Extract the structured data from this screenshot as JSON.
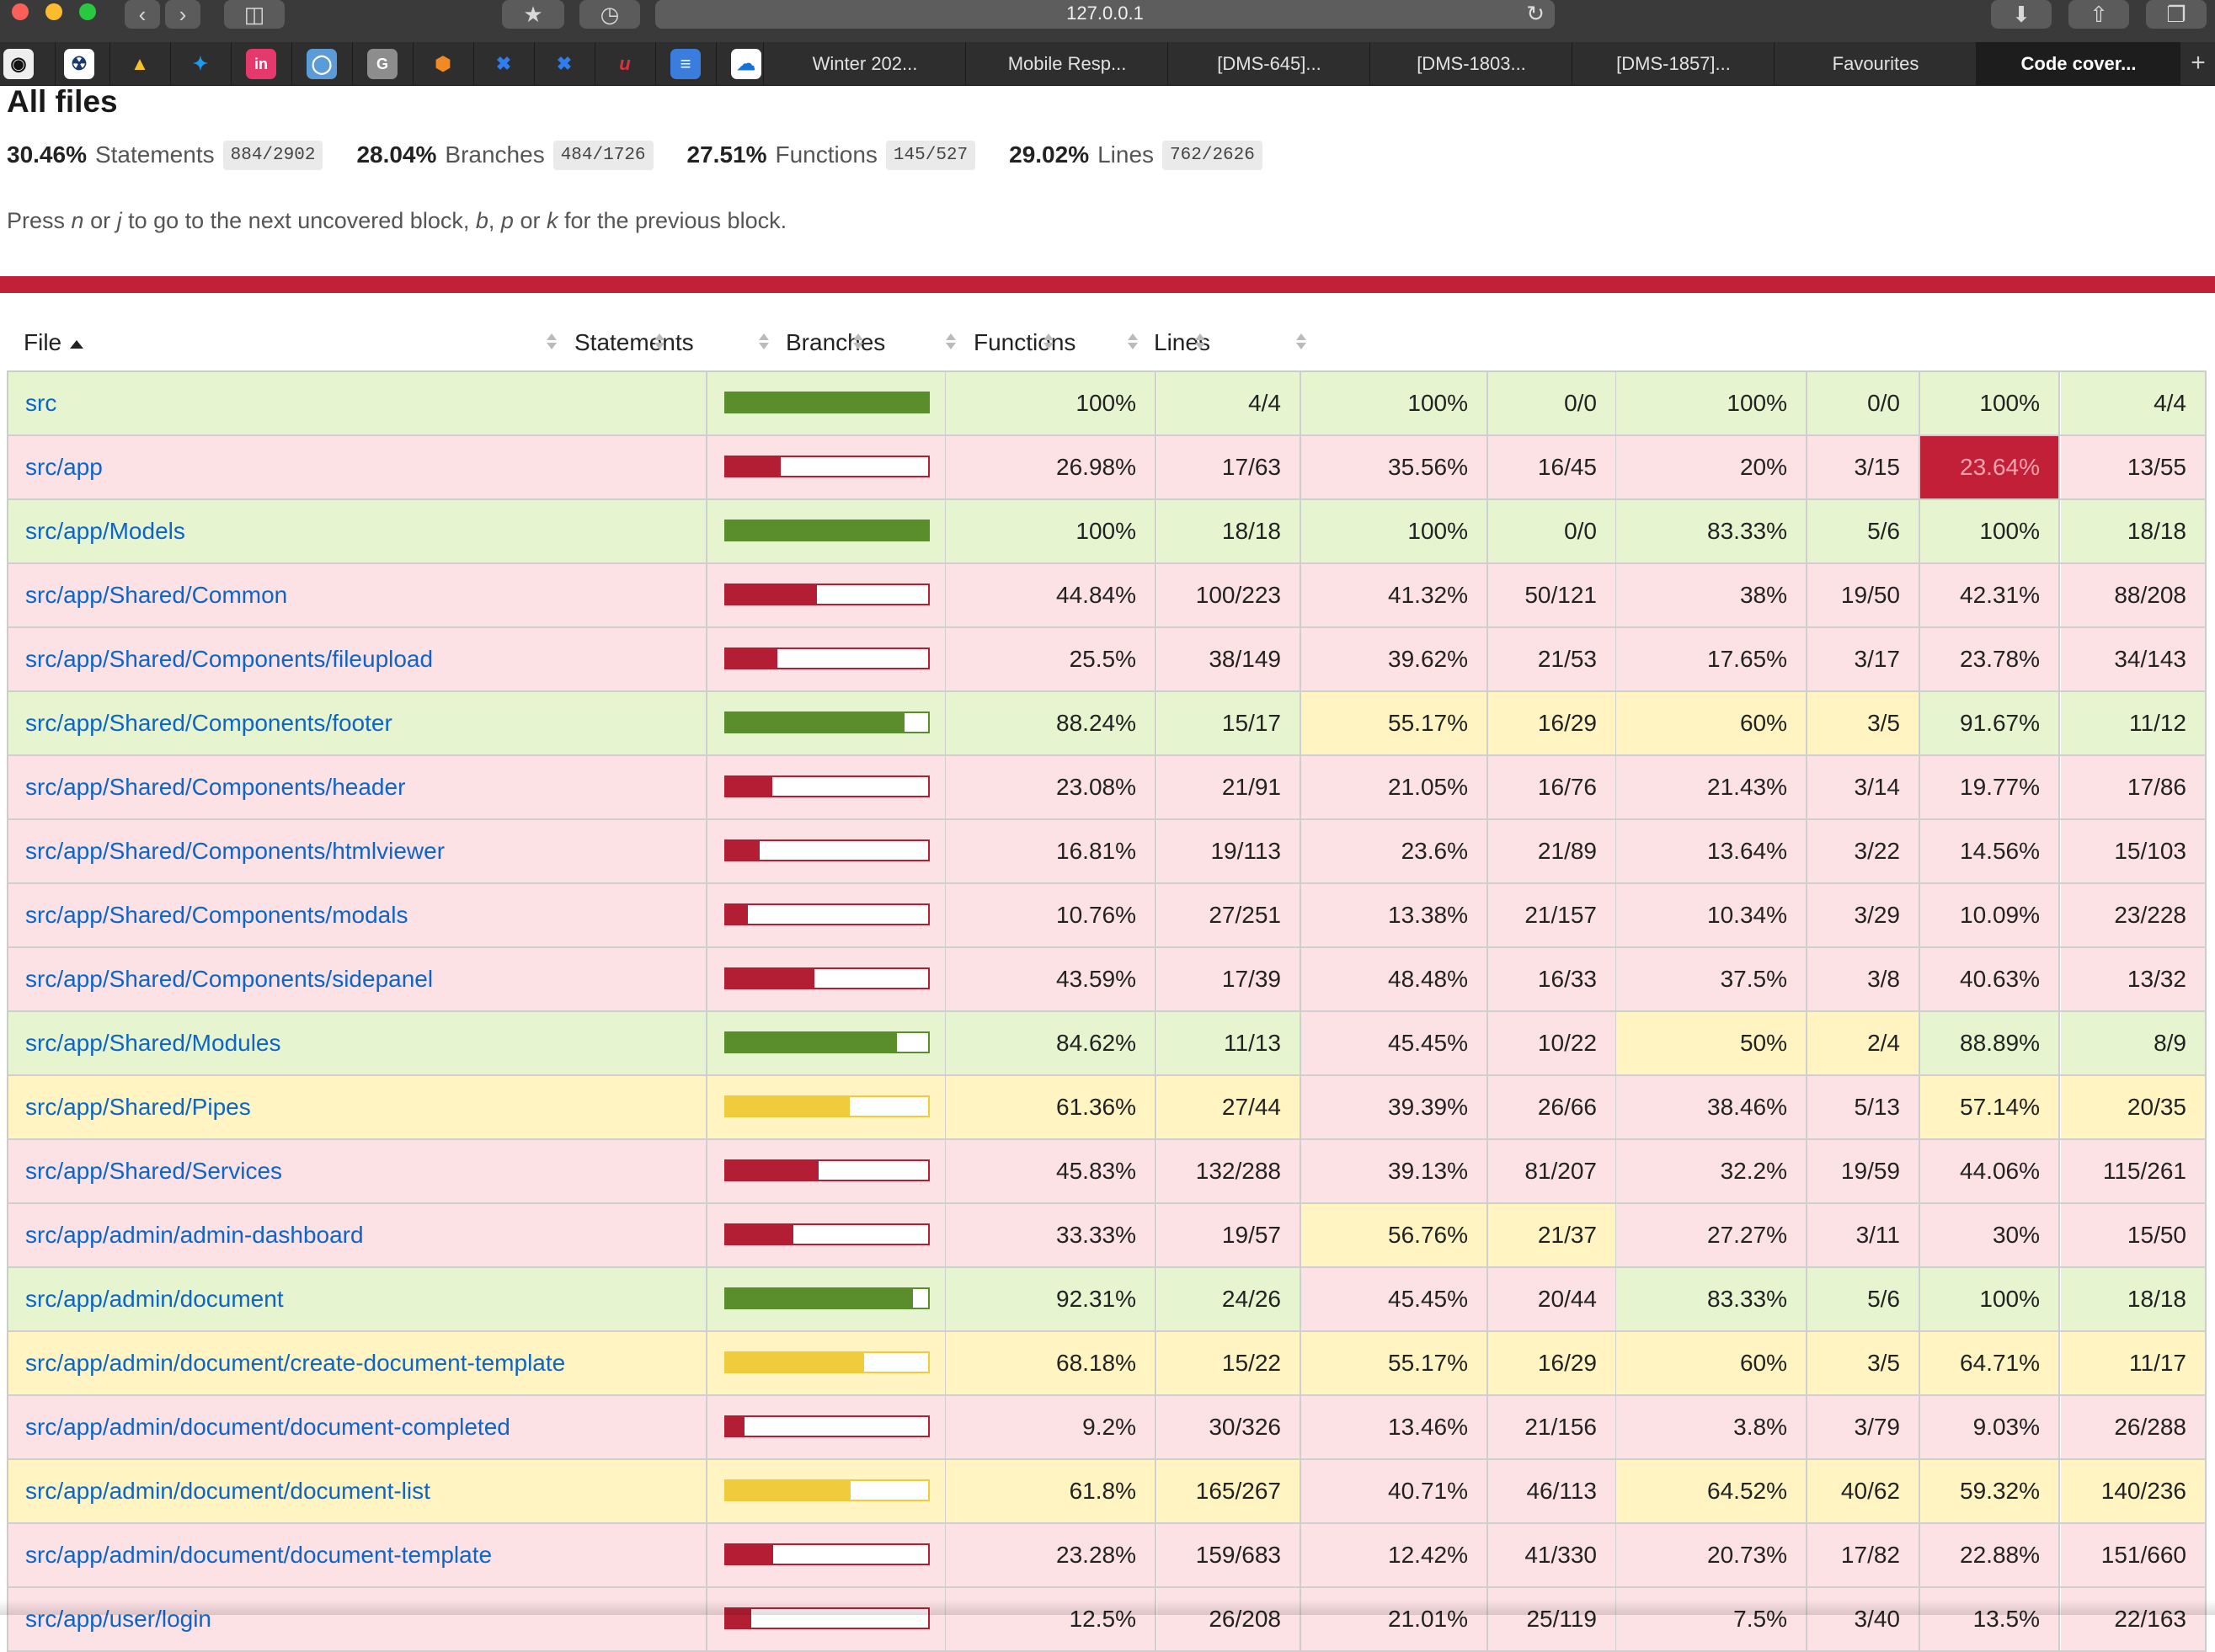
{
  "browser": {
    "url": "127.0.0.1",
    "tabs": [
      {
        "label": "Winter 202..."
      },
      {
        "label": "Mobile Resp..."
      },
      {
        "label": "[DMS-645]..."
      },
      {
        "label": "[DMS-1803..."
      },
      {
        "label": "[DMS-1857]..."
      },
      {
        "label": "Favourites"
      },
      {
        "label": "Code cover...",
        "active": true
      }
    ],
    "favorites_icons": [
      "github-icon",
      "bot-icon",
      "google-drive-icon",
      "twitter-icon",
      "invision-icon",
      "circle-app-icon",
      "grammarly-icon",
      "package-icon",
      "jira-icon",
      "jira-icon",
      "signature-icon",
      "google-docs-icon",
      "onedrive-icon"
    ]
  },
  "page": {
    "title": "All files",
    "summary": [
      {
        "pct": "30.46%",
        "label": "Statements",
        "fraction": "884/2902"
      },
      {
        "pct": "28.04%",
        "label": "Branches",
        "fraction": "484/1726"
      },
      {
        "pct": "27.51%",
        "label": "Functions",
        "fraction": "145/527"
      },
      {
        "pct": "29.02%",
        "label": "Lines",
        "fraction": "762/2626"
      }
    ],
    "hint": {
      "p1": "Press ",
      "k1": "n",
      "p2": " or ",
      "k2": "j",
      "p3": " to go to the next uncovered block, ",
      "k3": "b",
      "p4": ", ",
      "k4": "p",
      "p5": " or ",
      "k5": "k",
      "p6": " for the previous block."
    },
    "status_color": "#c21f39"
  },
  "table": {
    "headers": {
      "file": "File",
      "statements": "Statements",
      "branches": "Branches",
      "functions": "Functions",
      "lines": "Lines"
    },
    "rows": [
      {
        "file": "src",
        "bar": 1.0,
        "level": "high",
        "stmt_pct": "100%",
        "stmt": "4/4",
        "br_pct": "100%",
        "br": "0/0",
        "fn_pct": "100%",
        "fn": "0/0",
        "ln_pct": "100%",
        "ln": "4/4",
        "levels": [
          "high",
          "high",
          "high",
          "high"
        ]
      },
      {
        "file": "src/app",
        "bar": 0.2698,
        "level": "low",
        "stmt_pct": "26.98%",
        "stmt": "17/63",
        "br_pct": "35.56%",
        "br": "16/45",
        "fn_pct": "20%",
        "fn": "3/15",
        "ln_pct": "23.64%",
        "ln": "13/55",
        "levels": [
          "low",
          "low",
          "low",
          "alert"
        ]
      },
      {
        "file": "src/app/Models",
        "bar": 1.0,
        "level": "high",
        "stmt_pct": "100%",
        "stmt": "18/18",
        "br_pct": "100%",
        "br": "0/0",
        "fn_pct": "83.33%",
        "fn": "5/6",
        "ln_pct": "100%",
        "ln": "18/18",
        "levels": [
          "high",
          "high",
          "high",
          "high"
        ]
      },
      {
        "file": "src/app/Shared/Common",
        "bar": 0.4484,
        "level": "low",
        "stmt_pct": "44.84%",
        "stmt": "100/223",
        "br_pct": "41.32%",
        "br": "50/121",
        "fn_pct": "38%",
        "fn": "19/50",
        "ln_pct": "42.31%",
        "ln": "88/208",
        "levels": [
          "low",
          "low",
          "low",
          "low"
        ]
      },
      {
        "file": "src/app/Shared/Components/fileupload",
        "bar": 0.255,
        "level": "low",
        "stmt_pct": "25.5%",
        "stmt": "38/149",
        "br_pct": "39.62%",
        "br": "21/53",
        "fn_pct": "17.65%",
        "fn": "3/17",
        "ln_pct": "23.78%",
        "ln": "34/143",
        "levels": [
          "low",
          "low",
          "low",
          "low"
        ]
      },
      {
        "file": "src/app/Shared/Components/footer",
        "bar": 0.8824,
        "level": "high",
        "stmt_pct": "88.24%",
        "stmt": "15/17",
        "br_pct": "55.17%",
        "br": "16/29",
        "fn_pct": "60%",
        "fn": "3/5",
        "ln_pct": "91.67%",
        "ln": "11/12",
        "levels": [
          "high",
          "medium",
          "medium",
          "high"
        ]
      },
      {
        "file": "src/app/Shared/Components/header",
        "bar": 0.2308,
        "level": "low",
        "stmt_pct": "23.08%",
        "stmt": "21/91",
        "br_pct": "21.05%",
        "br": "16/76",
        "fn_pct": "21.43%",
        "fn": "3/14",
        "ln_pct": "19.77%",
        "ln": "17/86",
        "levels": [
          "low",
          "low",
          "low",
          "low"
        ]
      },
      {
        "file": "src/app/Shared/Components/htmlviewer",
        "bar": 0.1681,
        "level": "low",
        "stmt_pct": "16.81%",
        "stmt": "19/113",
        "br_pct": "23.6%",
        "br": "21/89",
        "fn_pct": "13.64%",
        "fn": "3/22",
        "ln_pct": "14.56%",
        "ln": "15/103",
        "levels": [
          "low",
          "low",
          "low",
          "low"
        ]
      },
      {
        "file": "src/app/Shared/Components/modals",
        "bar": 0.1076,
        "level": "low",
        "stmt_pct": "10.76%",
        "stmt": "27/251",
        "br_pct": "13.38%",
        "br": "21/157",
        "fn_pct": "10.34%",
        "fn": "3/29",
        "ln_pct": "10.09%",
        "ln": "23/228",
        "levels": [
          "low",
          "low",
          "low",
          "low"
        ]
      },
      {
        "file": "src/app/Shared/Components/sidepanel",
        "bar": 0.4359,
        "level": "low",
        "stmt_pct": "43.59%",
        "stmt": "17/39",
        "br_pct": "48.48%",
        "br": "16/33",
        "fn_pct": "37.5%",
        "fn": "3/8",
        "ln_pct": "40.63%",
        "ln": "13/32",
        "levels": [
          "low",
          "low",
          "low",
          "low"
        ]
      },
      {
        "file": "src/app/Shared/Modules",
        "bar": 0.8462,
        "level": "high",
        "stmt_pct": "84.62%",
        "stmt": "11/13",
        "br_pct": "45.45%",
        "br": "10/22",
        "fn_pct": "50%",
        "fn": "2/4",
        "ln_pct": "88.89%",
        "ln": "8/9",
        "levels": [
          "high",
          "low",
          "medium",
          "high"
        ]
      },
      {
        "file": "src/app/Shared/Pipes",
        "bar": 0.6136,
        "level": "medium",
        "stmt_pct": "61.36%",
        "stmt": "27/44",
        "br_pct": "39.39%",
        "br": "26/66",
        "fn_pct": "38.46%",
        "fn": "5/13",
        "ln_pct": "57.14%",
        "ln": "20/35",
        "levels": [
          "medium",
          "low",
          "low",
          "medium"
        ]
      },
      {
        "file": "src/app/Shared/Services",
        "bar": 0.4583,
        "level": "low",
        "stmt_pct": "45.83%",
        "stmt": "132/288",
        "br_pct": "39.13%",
        "br": "81/207",
        "fn_pct": "32.2%",
        "fn": "19/59",
        "ln_pct": "44.06%",
        "ln": "115/261",
        "levels": [
          "low",
          "low",
          "low",
          "low"
        ]
      },
      {
        "file": "src/app/admin/admin-dashboard",
        "bar": 0.3333,
        "level": "low",
        "stmt_pct": "33.33%",
        "stmt": "19/57",
        "br_pct": "56.76%",
        "br": "21/37",
        "fn_pct": "27.27%",
        "fn": "3/11",
        "ln_pct": "30%",
        "ln": "15/50",
        "levels": [
          "low",
          "medium",
          "low",
          "low"
        ]
      },
      {
        "file": "src/app/admin/document",
        "bar": 0.9231,
        "level": "high",
        "stmt_pct": "92.31%",
        "stmt": "24/26",
        "br_pct": "45.45%",
        "br": "20/44",
        "fn_pct": "83.33%",
        "fn": "5/6",
        "ln_pct": "100%",
        "ln": "18/18",
        "levels": [
          "high",
          "low",
          "high",
          "high"
        ]
      },
      {
        "file": "src/app/admin/document/create-document-template",
        "bar": 0.6818,
        "level": "medium",
        "stmt_pct": "68.18%",
        "stmt": "15/22",
        "br_pct": "55.17%",
        "br": "16/29",
        "fn_pct": "60%",
        "fn": "3/5",
        "ln_pct": "64.71%",
        "ln": "11/17",
        "levels": [
          "medium",
          "medium",
          "medium",
          "medium"
        ]
      },
      {
        "file": "src/app/admin/document/document-completed",
        "bar": 0.092,
        "level": "low",
        "stmt_pct": "9.2%",
        "stmt": "30/326",
        "br_pct": "13.46%",
        "br": "21/156",
        "fn_pct": "3.8%",
        "fn": "3/79",
        "ln_pct": "9.03%",
        "ln": "26/288",
        "levels": [
          "low",
          "low",
          "low",
          "low"
        ]
      },
      {
        "file": "src/app/admin/document/document-list",
        "bar": 0.618,
        "level": "medium",
        "stmt_pct": "61.8%",
        "stmt": "165/267",
        "br_pct": "40.71%",
        "br": "46/113",
        "fn_pct": "64.52%",
        "fn": "40/62",
        "ln_pct": "59.32%",
        "ln": "140/236",
        "levels": [
          "medium",
          "low",
          "medium",
          "medium"
        ]
      },
      {
        "file": "src/app/admin/document/document-template",
        "bar": 0.2328,
        "level": "low",
        "stmt_pct": "23.28%",
        "stmt": "159/683",
        "br_pct": "12.42%",
        "br": "41/330",
        "fn_pct": "20.73%",
        "fn": "17/82",
        "ln_pct": "22.88%",
        "ln": "151/660",
        "levels": [
          "low",
          "low",
          "low",
          "low"
        ]
      },
      {
        "file": "src/app/user/login",
        "bar": 0.125,
        "level": "low",
        "stmt_pct": "12.5%",
        "stmt": "26/208",
        "br_pct": "21.01%",
        "br": "25/119",
        "fn_pct": "7.5%",
        "fn": "3/40",
        "ln_pct": "13.5%",
        "ln": "22/163",
        "levels": [
          "low",
          "low",
          "low",
          "low"
        ]
      }
    ]
  },
  "colors": {
    "high_fill": "#5a8e2c",
    "medium_fill": "#f0cb3c",
    "low_fill": "#b41e34",
    "link": "#0d65c9"
  }
}
